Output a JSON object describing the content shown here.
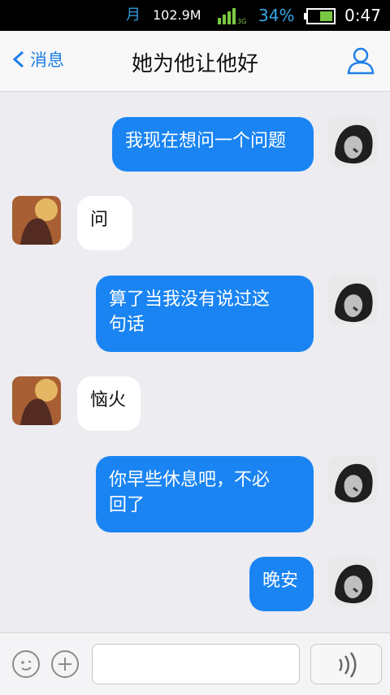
{
  "status_bar": {
    "calendar_icon": "calendar-icon",
    "calendar_label": "月",
    "speed": "102.9M",
    "signal_type": "3G",
    "battery_percent": "34%",
    "time": "0:47"
  },
  "nav": {
    "back_label": "消息",
    "title": "她为他让他好",
    "back_icon": "chevron-left-icon",
    "profile_icon": "user-profile-icon"
  },
  "messages": [
    {
      "from": "me",
      "text": "我现在想问一个问题"
    },
    {
      "from": "other",
      "text": "问"
    },
    {
      "from": "me",
      "text": "算了当我没有说过这\n句话"
    },
    {
      "from": "other",
      "text": "恼火"
    },
    {
      "from": "me",
      "text": "你早些休息吧，不必\n回了"
    },
    {
      "from": "me",
      "text": "晚安"
    }
  ],
  "input_bar": {
    "emoji_icon": "emoji-icon",
    "plus_icon": "plus-icon",
    "text_value": "",
    "voice_icon": "voice-icon"
  },
  "colors": {
    "outgoing_bubble": "#1a84f2",
    "incoming_bubble": "#ffffff",
    "accent": "#1e7fe6",
    "background": "#ececf1"
  }
}
